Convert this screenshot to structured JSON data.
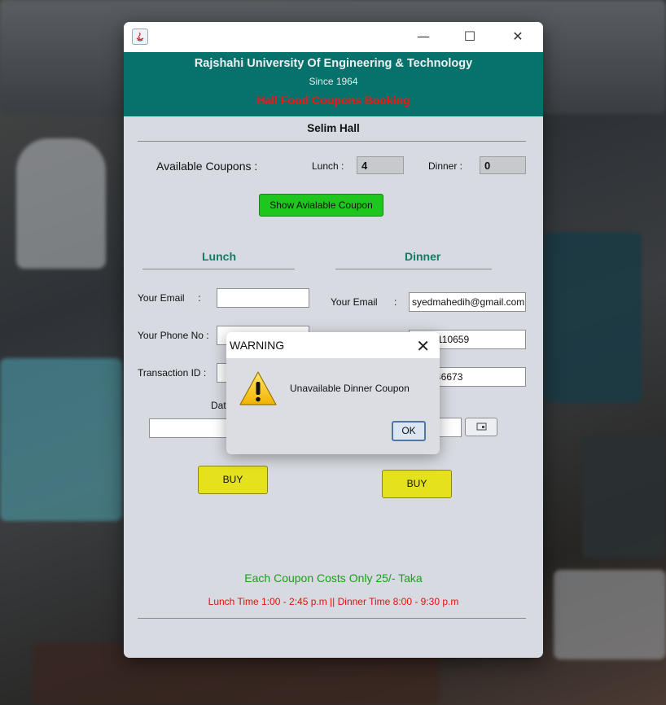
{
  "window": {
    "minimize_glyph": "—",
    "maximize_glyph": "☐",
    "close_glyph": "✕"
  },
  "header": {
    "university": "Rajshahi University Of Engineering & Technology",
    "since": "Since 1964",
    "booking_title": "Hall Food Coupons Booking"
  },
  "hall_name": "Selim Hall",
  "availability": {
    "label": "Available Coupons :",
    "lunch_label": "Lunch :",
    "lunch_count": "4",
    "dinner_label": "Dinner :",
    "dinner_count": "0",
    "show_button": "Show Avialable Coupon"
  },
  "lunch": {
    "title": "Lunch",
    "email_label": "Your Email     :",
    "email_value": "",
    "phone_label": "Your Phone No :",
    "phone_value": "",
    "transaction_label": "Transaction ID :",
    "transaction_value": "",
    "date_label": "Dat",
    "date_value": "",
    "buy_button": "BUY"
  },
  "dinner": {
    "title": "Dinner",
    "email_label": "Your Email",
    "email_colon": ":",
    "email_value": "syedmahedih@gmail.com",
    "phone_value": "110659",
    "transaction_value": "46673",
    "date_value": "",
    "buy_button": "BUY"
  },
  "footer": {
    "cost_text": "Each Coupon Costs Only 25/- Taka",
    "time_text": "Lunch Time 1:00 - 2:45 p.m  || Dinner Time 8:00 - 9:30 p.m"
  },
  "dialog": {
    "title": "WARNING",
    "close_glyph": "✕",
    "message": "Unavailable Dinner Coupon",
    "ok_button": "OK",
    "icon": "warning-icon"
  },
  "colors": {
    "header_bg": "#07716b",
    "booking_title": "#ff1010",
    "section_title": "#0f7d66",
    "show_button": "#1ec61e",
    "buy_button": "#e5e21d",
    "footer_cost": "#17a117",
    "footer_time": "#e01010"
  }
}
